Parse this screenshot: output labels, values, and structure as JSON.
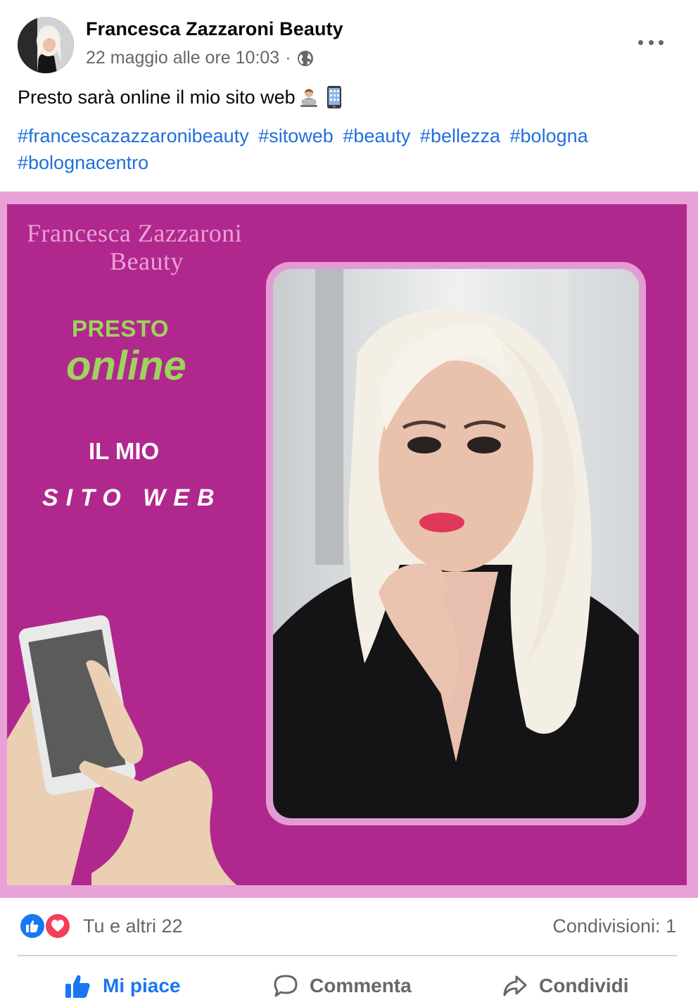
{
  "post": {
    "page_name": "Francesca Zazzaroni Beauty",
    "date": "22 maggio alle ore 10:03",
    "separator": "·",
    "text": "Presto sarà online il mio sito web",
    "hashtags": [
      "#francescazazzaronibeauty",
      "#sitoweb",
      "#beauty",
      "#bellezza",
      "#bologna",
      "#bolognacentro"
    ]
  },
  "image": {
    "brand_line1": "Francesca Zazzaroni",
    "brand_line2": "Beauty",
    "presto": "PRESTO",
    "online": "online",
    "il_mio": "IL MIO",
    "sito_web": "SITO WEB"
  },
  "reactions": {
    "count_text": "Tu e altri 22",
    "shares_text": "Condivisioni: 1"
  },
  "actions": {
    "like": "Mi piace",
    "comment": "Commenta",
    "share": "Condividi"
  },
  "colors": {
    "link": "#216fdb",
    "like_blue": "#1877f2",
    "magenta": "#b0288d",
    "pink_border": "#e8a1d6",
    "lime": "#9ed35d"
  },
  "icons": [
    "globe-icon",
    "more-icon",
    "like-reaction-icon",
    "love-reaction-icon",
    "thumbs-up-icon",
    "comment-icon",
    "share-icon"
  ]
}
